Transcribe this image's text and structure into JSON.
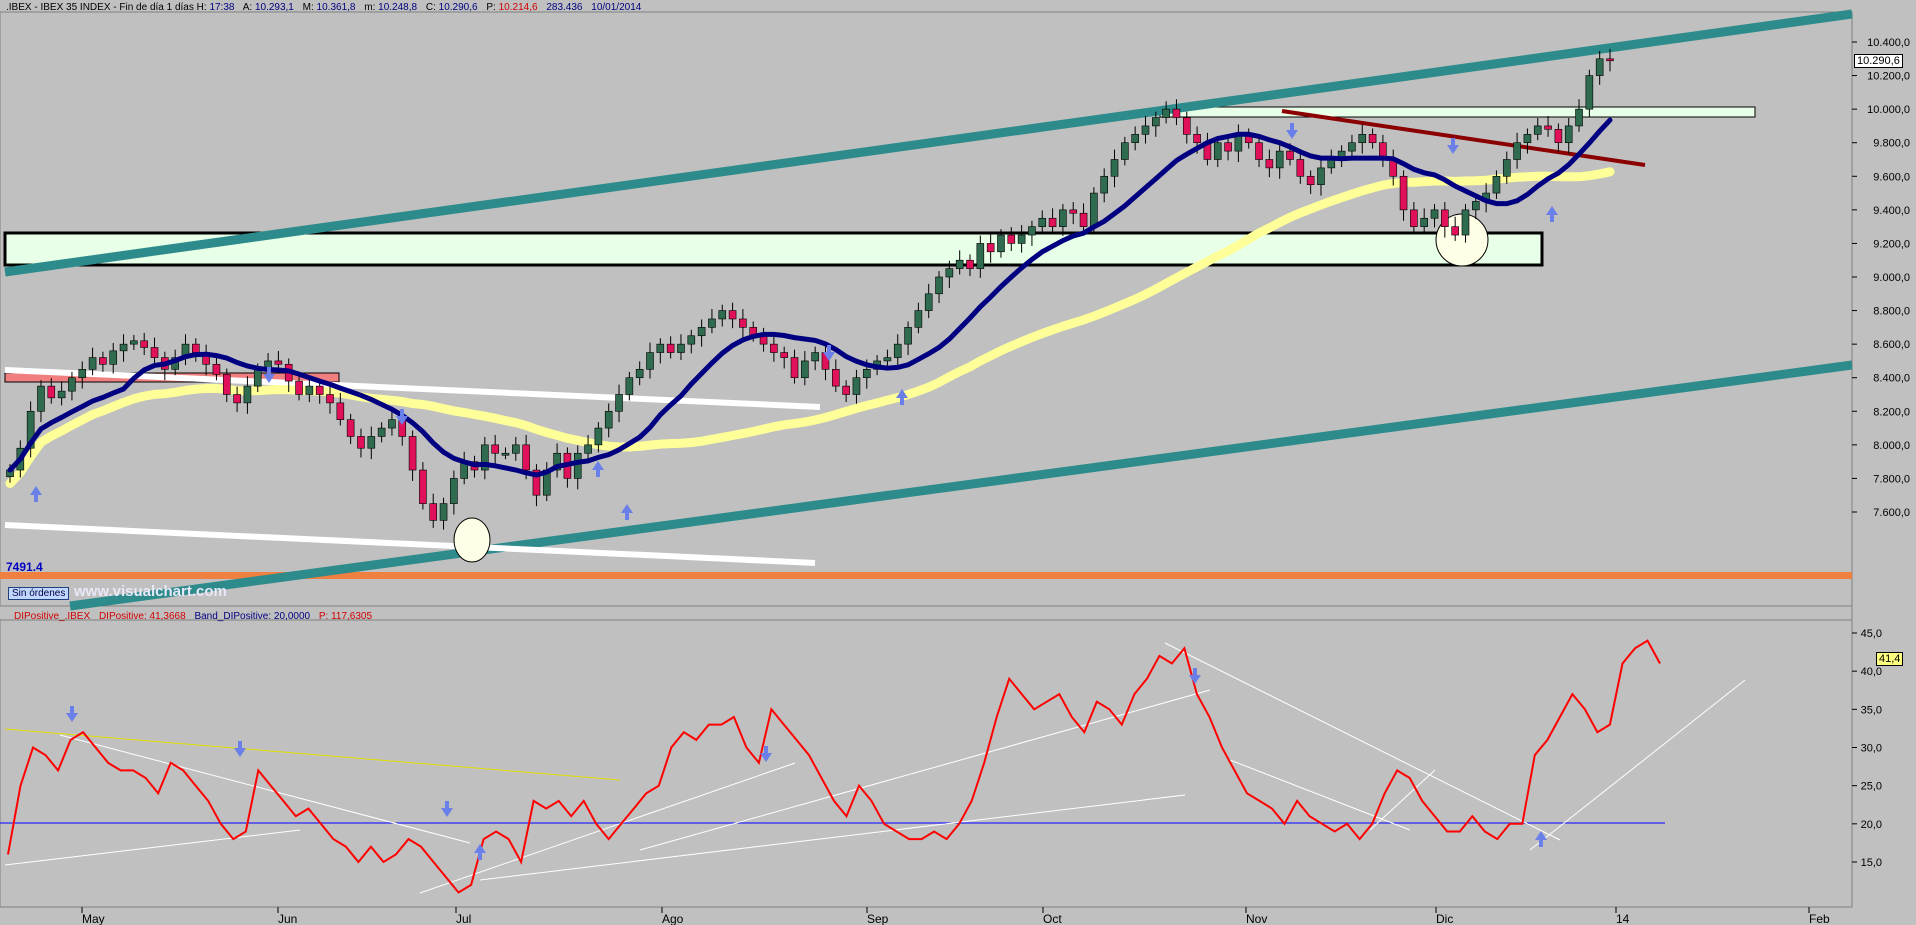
{
  "header": {
    "symbol": ".IBEX - IBEX 35 INDEX - Fin de día 1 días",
    "h_label": "H:",
    "h_value": "17:38",
    "a_label": "A:",
    "a_value": "10.293,1",
    "m_label": "M:",
    "m_value": "10.361,8",
    "min_label": "m:",
    "min_value": "10.248,8",
    "c_label": "C:",
    "c_value": "10.290,6",
    "p_label": "P:",
    "p_value": "10.214,6",
    "vol_value": "283.436",
    "date": "10/01/2014"
  },
  "indicator_header": {
    "name": "DIPositive_.IBEX",
    "value_label": "DIPositive: 41,3668",
    "band_label": "Band_DIPositive: 20,0000",
    "p_label": "P: 117,6305"
  },
  "price_tag": "10.290,6",
  "ind_tag": "41,4",
  "low_label": "7491.4",
  "orders_button": "Sin órdenes",
  "watermark": "www.visualchart.com",
  "colors": {
    "background": "#c0c0c0",
    "channel": "#2e8b8b",
    "support_band": "#e8ffe8",
    "mean_blue": "#000080",
    "mean_yellow": "#ffff99",
    "up_candle": "#2e6b4f",
    "down_candle": "#e0105a",
    "di_line": "#ff0000",
    "band_line": "#0000ff"
  },
  "chart_data": [
    {
      "type": "candlestick",
      "title": "IBEX 35 INDEX",
      "y_ticks": [
        "10.400,0",
        "10.200,0",
        "10.000,0",
        "9.800,0",
        "9.600,0",
        "9.400,0",
        "9.200,0",
        "9.000,0",
        "8.800,0",
        "8.600,0",
        "8.400,0",
        "8.200,0",
        "8.000,0",
        "7.800,0",
        "7.600,0"
      ],
      "ylim": [
        7400,
        10560
      ],
      "x_ticks": [
        "May",
        "Jun",
        "Jul",
        "Ago",
        "Sep",
        "Oct",
        "Nov",
        "Dic",
        "14",
        "Feb"
      ],
      "close": [
        7850,
        7980,
        8200,
        8350,
        8280,
        8320,
        8400,
        8450,
        8520,
        8480,
        8560,
        8600,
        8620,
        8580,
        8520,
        8450,
        8520,
        8600,
        8550,
        8480,
        8420,
        8300,
        8250,
        8350,
        8450,
        8500,
        8480,
        8380,
        8300,
        8350,
        8300,
        8250,
        8150,
        8050,
        7980,
        8050,
        8100,
        8150,
        8050,
        7850,
        7650,
        7550,
        7650,
        7800,
        7900,
        7850,
        8000,
        7950,
        7950,
        8000,
        7850,
        7700,
        7850,
        7950,
        7800,
        7950,
        8000,
        8100,
        8200,
        8300,
        8400,
        8450,
        8550,
        8600,
        8550,
        8600,
        8650,
        8700,
        8750,
        8800,
        8750,
        8700,
        8650,
        8600,
        8550,
        8520,
        8400,
        8500,
        8550,
        8450,
        8350,
        8300,
        8400,
        8450,
        8500,
        8520,
        8600,
        8700,
        8800,
        8900,
        9000,
        9050,
        9100,
        9050,
        9200,
        9150,
        9250,
        9200,
        9250,
        9300,
        9350,
        9300,
        9400,
        9380,
        9300,
        9500,
        9600,
        9700,
        9800,
        9850,
        9900,
        9950,
        10000,
        9950,
        9850,
        9800,
        9700,
        9800,
        9750,
        9850,
        9800,
        9700,
        9650,
        9750,
        9700,
        9600,
        9550,
        9650,
        9700,
        9750,
        9800,
        9850,
        9800,
        9700,
        9600,
        9400,
        9300,
        9350,
        9400,
        9300,
        9250,
        9400,
        9450,
        9500,
        9600,
        9700,
        9800,
        9850,
        9900,
        9880,
        9800,
        9900,
        10000,
        10200,
        10300,
        10290
      ]
    },
    {
      "type": "line",
      "title": "DIPositive_.IBEX",
      "y_ticks": [
        "45,0",
        "40,0",
        "35,0",
        "30,0",
        "25,0",
        "20,0",
        "15,0"
      ],
      "ylim": [
        10,
        46
      ],
      "band": 20,
      "series": [
        {
          "name": "DIPositive",
          "values": [
            16,
            25,
            30,
            29,
            27,
            31,
            32,
            30,
            28,
            27,
            27,
            26,
            24,
            28,
            27,
            25,
            23,
            20,
            18,
            19,
            27,
            25,
            23,
            21,
            22,
            20,
            18,
            17,
            15,
            17,
            15,
            16,
            18,
            17,
            15,
            13,
            11,
            12,
            18,
            19,
            18,
            15,
            23,
            22,
            23,
            21,
            23,
            20,
            18,
            20,
            22,
            24,
            25,
            30,
            32,
            31,
            33,
            33,
            34,
            30,
            28,
            35,
            33,
            31,
            29,
            26,
            23,
            21,
            25,
            23,
            20,
            19,
            18,
            18,
            19,
            18,
            20,
            23,
            28,
            34,
            39,
            37,
            35,
            36,
            37,
            34,
            32,
            36,
            35,
            33,
            37,
            39,
            42,
            41,
            43,
            37,
            34,
            30,
            27,
            24,
            23,
            22,
            20,
            23,
            21,
            20,
            19,
            20,
            18,
            20,
            24,
            27,
            26,
            23,
            21,
            19,
            19,
            21,
            19,
            18,
            20,
            20,
            29,
            31,
            34,
            37,
            35,
            32,
            33,
            41,
            43,
            44,
            41
          ]
        },
        {
          "name": "Band_DIPositive",
          "values": [
            20
          ]
        }
      ]
    }
  ]
}
